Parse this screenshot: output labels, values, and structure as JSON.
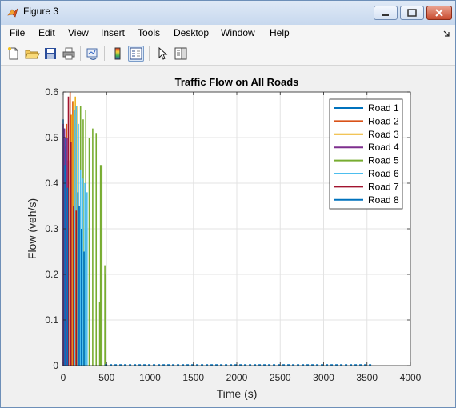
{
  "window": {
    "title": "Figure 3",
    "controls": {
      "minimize_icon": "minimize-icon",
      "maximize_icon": "maximize-icon",
      "close_icon": "close-icon"
    }
  },
  "menu": {
    "items": [
      "File",
      "Edit",
      "View",
      "Insert",
      "Tools",
      "Desktop",
      "Window",
      "Help"
    ],
    "dock_arrow_icon": "dock-arrow-icon"
  },
  "toolbar": {
    "icons": [
      "new-figure-icon",
      "open-file-icon",
      "save-icon",
      "print-icon",
      "link-plot-icon",
      "colorbar-icon",
      "legend-icon",
      "pointer-icon",
      "property-editor-icon"
    ]
  },
  "colors": {
    "road1": "#0072BD",
    "road2": "#D95319",
    "road3": "#EDB120",
    "road4": "#7E2F8E",
    "road5": "#77AC30",
    "road6": "#4DBEEE",
    "road7": "#A2142F",
    "road8": "#0072BD"
  },
  "chart_data": {
    "type": "line",
    "title": "Traffic Flow on All Roads",
    "xlabel": "Time (s)",
    "ylabel": "Flow (veh/s)",
    "xlim": [
      0,
      4000
    ],
    "ylim": [
      0,
      0.6
    ],
    "xticks": [
      "0",
      "500",
      "1000",
      "1500",
      "2000",
      "2500",
      "3000",
      "3500",
      "4000"
    ],
    "yticks": [
      "0",
      "0.1",
      "0.2",
      "0.3",
      "0.4",
      "0.5",
      "0.6"
    ],
    "grid": true,
    "legend_position": "top-right",
    "series": [
      {
        "name": "Road 1",
        "color": "#0072BD",
        "spikes": [
          [
            0,
            0.54
          ],
          [
            10,
            0.52
          ],
          [
            20,
            0.5
          ],
          [
            30,
            0.48
          ],
          [
            40,
            0.46
          ],
          [
            3580,
            0.0
          ]
        ]
      },
      {
        "name": "Road 2",
        "color": "#D95319",
        "spikes": [
          [
            40,
            0.53
          ],
          [
            60,
            0.45
          ],
          [
            80,
            0.6
          ],
          [
            95,
            0.55
          ],
          [
            110,
            0.58
          ]
        ]
      },
      {
        "name": "Road 3",
        "color": "#EDB120",
        "spikes": [
          [
            100,
            0.55
          ],
          [
            120,
            0.58
          ],
          [
            140,
            0.59
          ],
          [
            155,
            0.57
          ]
        ]
      },
      {
        "name": "Road 4",
        "color": "#7E2F8E",
        "spikes": [
          [
            0,
            0.53
          ],
          [
            15,
            0.52
          ],
          [
            45,
            0.5
          ]
        ]
      },
      {
        "name": "Road 5",
        "color": "#77AC30",
        "spikes": [
          [
            200,
            0.57
          ],
          [
            230,
            0.54
          ],
          [
            260,
            0.56
          ],
          [
            300,
            0.5
          ],
          [
            340,
            0.52
          ],
          [
            380,
            0.51
          ],
          [
            430,
            0.44
          ],
          [
            445,
            0.44
          ],
          [
            480,
            0.22
          ],
          [
            490,
            0.2
          ],
          [
            420,
            0.14
          ]
        ]
      },
      {
        "name": "Road 6",
        "color": "#4DBEEE",
        "spikes": [
          [
            130,
            0.56
          ],
          [
            150,
            0.57
          ],
          [
            175,
            0.53
          ],
          [
            200,
            0.43
          ],
          [
            225,
            0.41
          ],
          [
            250,
            0.4
          ],
          [
            275,
            0.38
          ]
        ]
      },
      {
        "name": "Road 7",
        "color": "#A2142F",
        "spikes": [
          [
            60,
            0.59
          ],
          [
            90,
            0.49
          ],
          [
            120,
            0.35
          ],
          [
            150,
            0.34
          ]
        ]
      },
      {
        "name": "Road 8",
        "color": "#0072BD",
        "spikes": [
          [
            20,
            0.44
          ],
          [
            50,
            0.39
          ],
          [
            170,
            0.38
          ],
          [
            185,
            0.35
          ],
          [
            210,
            0.3
          ],
          [
            240,
            0.25
          ]
        ]
      }
    ]
  }
}
